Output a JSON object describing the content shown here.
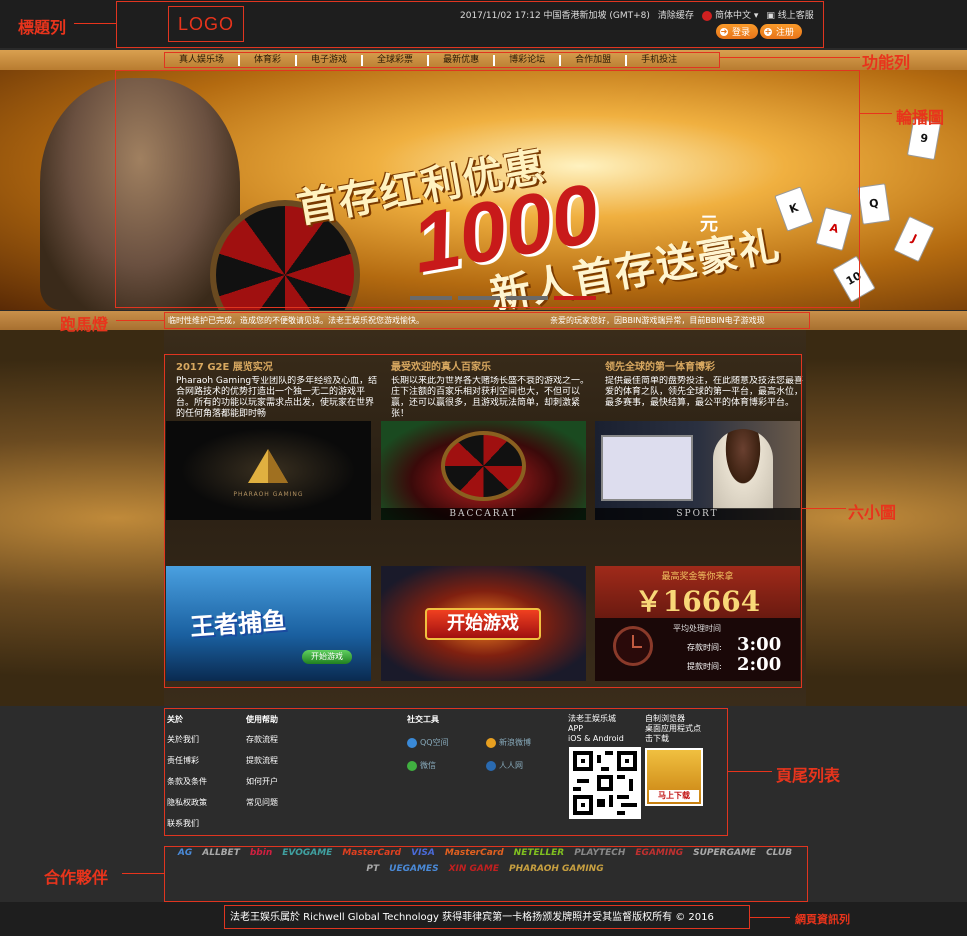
{
  "annotations": {
    "header": "標題列",
    "nav": "功能列",
    "banner": "輪播圖",
    "marquee": "跑馬燈",
    "tiles": "六小圖",
    "footer_list": "頁尾列表",
    "partners": "合作夥伴",
    "info": "網頁資訊列",
    "color": "#e8341c"
  },
  "header": {
    "logo": "LOGO",
    "datetime": "2017/11/02 17:12 中国香港新加坡 (GMT+8)",
    "clear_cache": "清除缓存",
    "language": "简体中文",
    "support": "线上客服",
    "login": "登录",
    "register": "注册"
  },
  "nav": {
    "items": [
      "真人娱乐场",
      "体育彩",
      "电子游戏",
      "全球彩票",
      "最新优惠",
      "博彩论坛",
      "合作加盟",
      "手机投注"
    ]
  },
  "banner": {
    "line1": "首存红利优惠",
    "amount": "1000",
    "unit": "元",
    "line2": "新人首存送豪礼",
    "slide_count": 4,
    "active_slide": 4
  },
  "marquee": {
    "left": "临时性维护已完成，造成您的不便敬请见谅。法老王娱乐祝您游戏愉快。",
    "right": "亲爱的玩家您好，因BBIN游戏端异常，目前BBIN电子游戏现"
  },
  "features": [
    {
      "title": "2017 G2E 展览实况",
      "text": "Pharaoh Gaming专业团队的多年经验及心血，结合网路技术的优势打造出一个独一无二的游戏平台。所有的功能以玩家需求点出发，使玩家在世界的任何角落都能即时畅",
      "caption": ""
    },
    {
      "title": "最受欢迎的真人百家乐",
      "text": "长期以来此为世界各大赌场长盛不衰的游戏之一。庄下注额的百家乐相对获利空间也大，不但可以赢，还可以赢很多，且游戏玩法简单，却刺激紧张！",
      "caption": "BACCARAT"
    },
    {
      "title": "领先全球的第一体育博彩",
      "text": "提供最佳简单的盘势投注，在此随意及技法您最喜爱的体育之队，领先全球的第一平台，最高水位，最多赛事，最快结算，最公平的体育博彩平台。",
      "caption": "SPORT"
    }
  ],
  "tiles": {
    "pharaoh_text": "PHARAOH GAMING",
    "fishing_title": "王者捕鱼",
    "fishing_btn": "开始游戏",
    "start_game": "开始游戏",
    "jackpot_head": "最高奖金等你来拿",
    "jackpot": "￥16664",
    "avg_time": "平均处理时间",
    "deposit_label": "存款时间:",
    "deposit_time": "3:00",
    "withdraw_label": "提款时间:",
    "withdraw_time": "2:00"
  },
  "footer": {
    "about": {
      "head": "关於",
      "links": [
        "关於我们",
        "责任博彩",
        "条款及条件",
        "隐私权政策",
        "联系我们"
      ]
    },
    "help": {
      "head": "使用帮助",
      "links": [
        "存款流程",
        "提款流程",
        "如何开户",
        "常见问题"
      ]
    },
    "social": {
      "head": "社交工具",
      "items": [
        "QQ空间",
        "新浪微博",
        "微信",
        "人人网"
      ]
    },
    "app": {
      "line1": "法老王娱乐城",
      "line2": "APP",
      "line3": "iOS & Android"
    },
    "browser": {
      "line1": "自制浏览器",
      "line2": "桌面应用程式点",
      "line3": "击下载",
      "btn": "马上下载"
    }
  },
  "partners": [
    "AG",
    "ALLBET",
    "bbin",
    "EVOGAME",
    "MasterCard",
    "VISA",
    "MasterCard",
    "NETELLER",
    "PLAYTECH",
    "EGAMING",
    "SUPERGAME",
    "CLUB",
    "PT",
    "UEGAMES",
    "XIN GAME",
    "PHARAOH GAMING"
  ],
  "copyright": "法老王娱乐属於 Richwell Global Technology 获得菲律宾第一卡格扬颁发牌照并受其监督版权所有 © 2016"
}
